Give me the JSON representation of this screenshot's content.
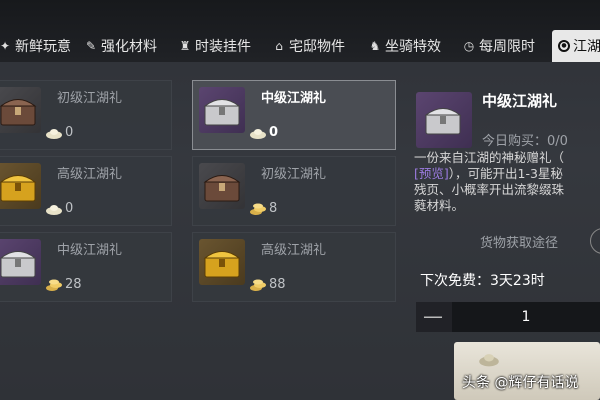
{
  "tabs": [
    {
      "label": "新鲜玩意",
      "icon": "star-icon"
    },
    {
      "label": "强化材料",
      "icon": "wrench-icon"
    },
    {
      "label": "时装挂件",
      "icon": "costume-icon"
    },
    {
      "label": "宅邸物件",
      "icon": "house-icon"
    },
    {
      "label": "坐骑特效",
      "icon": "horse-icon"
    },
    {
      "label": "每周限时",
      "icon": "clock-icon"
    },
    {
      "label": "江湖",
      "icon": "target-icon"
    }
  ],
  "items": [
    {
      "name": "初级江湖礼",
      "cost": "0",
      "currency": "silver-ingot-icon",
      "chest": "brown"
    },
    {
      "name": "中级江湖礼",
      "cost": "0",
      "currency": "silver-ingot-icon",
      "chest": "silver"
    },
    {
      "name": "高级江湖礼",
      "cost": "0",
      "currency": "silver-ingot-icon",
      "chest": "gold"
    },
    {
      "name": "初级江湖礼",
      "cost": "8",
      "currency": "gold-ingot-icon",
      "chest": "brown"
    },
    {
      "name": "中级江湖礼",
      "cost": "28",
      "currency": "gold-ingot-icon",
      "chest": "silver"
    },
    {
      "name": "高级江湖礼",
      "cost": "88",
      "currency": "gold-ingot-icon",
      "chest": "gold"
    }
  ],
  "detail": {
    "name": "中级江湖礼",
    "today_label": "今日购买：0/0",
    "desc_1": "一份来自江湖的神秘赠礼（",
    "desc_tag": "[预览]",
    "desc_2": "），可能开出1-3星秘",
    "desc_3": "残页、小概率开出流黎缀珠",
    "desc_4": "蕤材料。",
    "source_label": "货物获取途径",
    "help_icon": "?",
    "free_label": "下次免费：3天23时",
    "quantity": "1",
    "minus_label": "—"
  },
  "watermark": {
    "prefix": "头条",
    "handle": "@辉仔有话说"
  },
  "colors": {
    "selected_border": "#8a8d92",
    "preview_tag": "#9b7be0",
    "buy_button": "#e9e5da"
  }
}
